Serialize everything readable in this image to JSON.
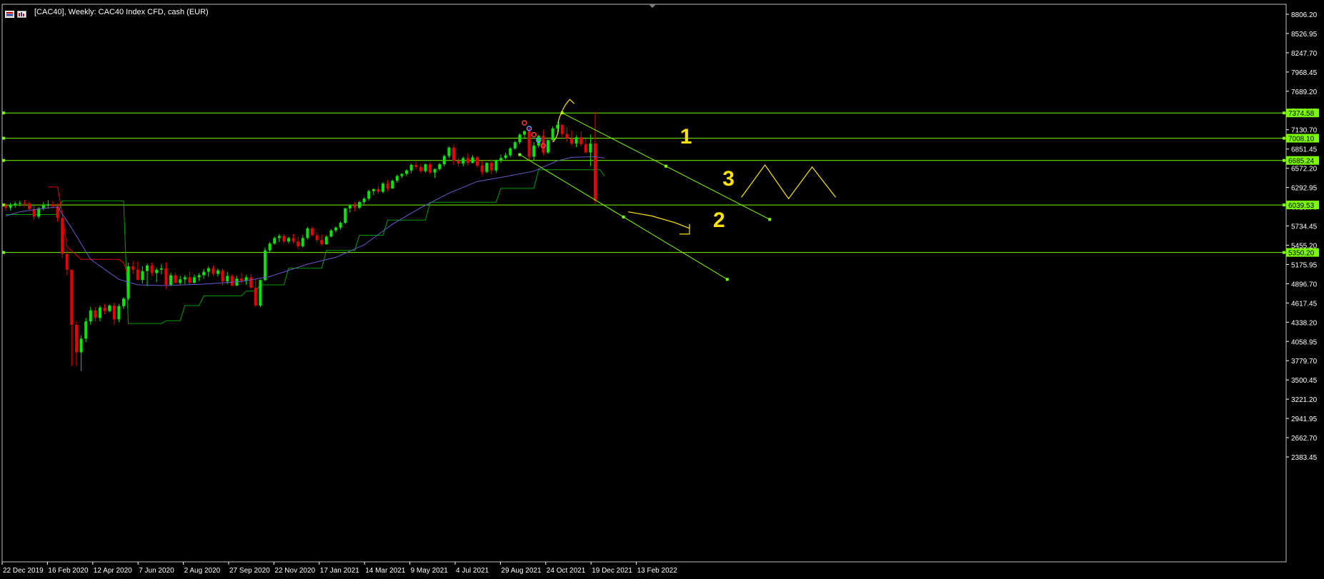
{
  "window": {
    "title": "[CAC40], Weekly:  CAC40 Index CFD, cash (EUR)"
  },
  "colors": {
    "bull": "#00e600",
    "bear": "#e60000",
    "hline": "#7cfc00",
    "ma": "#6a5acd",
    "stopUp": "#00a000",
    "stopDown": "#e00000",
    "annotation": "#ffe400",
    "grid": "#ffffff"
  },
  "chart_data": {
    "type": "candlestick",
    "symbol": "CAC40",
    "timeframe": "Weekly",
    "instrument": "CAC40 Index CFD, cash (EUR)",
    "y_ticks": [
      8806.2,
      8526.95,
      8247.7,
      7968.45,
      7689.2,
      7409.95,
      7130.7,
      6851.45,
      6572.2,
      6292.95,
      6013.7,
      5734.45,
      5455.2,
      5175.95,
      4896.7,
      4617.45,
      4338.2,
      4058.95,
      3779.7,
      3500.45,
      3221.2,
      2941.95,
      2662.7,
      2383.45
    ],
    "y_tick_labels": [
      "8806.20",
      "8526.95",
      "8247.70",
      "7968.45",
      "7689.20",
      "7409.95",
      "7130.70",
      "6851.45",
      "6572.20",
      "6292.95",
      "6013.70",
      "5734.45",
      "5455.20",
      "5175.95",
      "4896.70",
      "4617.45",
      "4338.20",
      "4058.95",
      "3779.70",
      "3500.45",
      "3221.20",
      "2941.95",
      "2662.70",
      "2383.45"
    ],
    "x_tick_labels": [
      "22 Dec 2019",
      "16 Feb 2020",
      "12 Apr 2020",
      "7 Jun 2020",
      "2 Aug 2020",
      "27 Sep 2020",
      "22 Nov 2020",
      "17 Jan 2021",
      "14 Mar 2021",
      "9 May 2021",
      "4 Jul 2021",
      "29 Aug 2021",
      "24 Oct 2021",
      "19 Dec 2021",
      "13 Feb 2022"
    ],
    "horizontal_levels": [
      {
        "value": 7374.58,
        "label": "7374.58"
      },
      {
        "value": 7008.1,
        "label": "7008.10"
      },
      {
        "value": 6685.24,
        "label": "6685.24"
      },
      {
        "value": 6039.53,
        "label": "6039.53"
      },
      {
        "value": 5350.2,
        "label": "5350.20"
      }
    ],
    "candles": [
      [
        6030,
        6060,
        5960,
        6000
      ],
      [
        6000,
        6070,
        5960,
        6040
      ],
      [
        6040,
        6090,
        6000,
        6060
      ],
      [
        6060,
        6100,
        6020,
        6070
      ],
      [
        6070,
        6110,
        6020,
        6060
      ],
      [
        6060,
        6090,
        5960,
        5980
      ],
      [
        5980,
        6030,
        5820,
        5870
      ],
      [
        5870,
        6010,
        5840,
        5990
      ],
      [
        5990,
        6080,
        5960,
        6040
      ],
      [
        6040,
        6110,
        5990,
        6050
      ],
      [
        6050,
        6100,
        5990,
        6020
      ],
      [
        6020,
        6060,
        5800,
        5850
      ],
      [
        5850,
        5860,
        5270,
        5330
      ],
      [
        5330,
        5400,
        5020,
        5100
      ],
      [
        5100,
        4650,
        3700,
        4300
      ],
      [
        4300,
        4350,
        3700,
        3900
      ],
      [
        3900,
        4150,
        3630,
        4100
      ],
      [
        4100,
        4400,
        4050,
        4350
      ],
      [
        4350,
        4560,
        4300,
        4510
      ],
      [
        4510,
        4560,
        4350,
        4400
      ],
      [
        4400,
        4580,
        4350,
        4550
      ],
      [
        4550,
        4600,
        4450,
        4500
      ],
      [
        4500,
        4600,
        4480,
        4580
      ],
      [
        4580,
        4620,
        4300,
        4380
      ],
      [
        4380,
        4600,
        4340,
        4570
      ],
      [
        4570,
        4700,
        4530,
        4680
      ],
      [
        4680,
        5200,
        4650,
        5150
      ],
      [
        5150,
        5230,
        5040,
        5100
      ],
      [
        5100,
        5220,
        5010,
        4950
      ],
      [
        4950,
        5150,
        4900,
        5080
      ],
      [
        5080,
        5190,
        4860,
        5160
      ],
      [
        5160,
        5200,
        5010,
        5050
      ],
      [
        5050,
        5130,
        4920,
        5100
      ],
      [
        5100,
        5180,
        5030,
        5120
      ],
      [
        5120,
        5210,
        4820,
        4880
      ],
      [
        4880,
        5060,
        4860,
        5020
      ],
      [
        5020,
        5060,
        4900,
        4910
      ],
      [
        4910,
        5010,
        4880,
        4960
      ],
      [
        4960,
        5020,
        4890,
        4990
      ],
      [
        4990,
        5070,
        4880,
        4910
      ],
      [
        4910,
        5030,
        4900,
        4990
      ],
      [
        4990,
        5050,
        4940,
        5020
      ],
      [
        5020,
        5110,
        4970,
        5070
      ],
      [
        5070,
        5150,
        5000,
        5120
      ],
      [
        5120,
        5160,
        5010,
        5040
      ],
      [
        5040,
        5120,
        5000,
        5090
      ],
      [
        5090,
        5120,
        4870,
        4930
      ],
      [
        4930,
        5070,
        4890,
        5010
      ],
      [
        5010,
        5040,
        4850,
        4870
      ],
      [
        4870,
        5010,
        4860,
        4970
      ],
      [
        4970,
        5050,
        4900,
        4940
      ],
      [
        4940,
        5020,
        4880,
        4990
      ],
      [
        4990,
        5040,
        4820,
        4840
      ],
      [
        4840,
        4970,
        4560,
        4580
      ],
      [
        4580,
        4960,
        4560,
        4950
      ],
      [
        4950,
        5420,
        4930,
        5380
      ],
      [
        5380,
        5500,
        5350,
        5480
      ],
      [
        5480,
        5580,
        5460,
        5560
      ],
      [
        5560,
        5620,
        5500,
        5590
      ],
      [
        5590,
        5620,
        5480,
        5510
      ],
      [
        5510,
        5580,
        5480,
        5560
      ],
      [
        5560,
        5620,
        5480,
        5510
      ],
      [
        5510,
        5580,
        5400,
        5440
      ],
      [
        5440,
        5600,
        5420,
        5560
      ],
      [
        5560,
        5720,
        5540,
        5700
      ],
      [
        5700,
        5730,
        5580,
        5600
      ],
      [
        5600,
        5640,
        5500,
        5530
      ],
      [
        5530,
        5610,
        5440,
        5470
      ],
      [
        5470,
        5600,
        5460,
        5580
      ],
      [
        5580,
        5690,
        5570,
        5670
      ],
      [
        5670,
        5730,
        5640,
        5710
      ],
      [
        5710,
        5800,
        5680,
        5780
      ],
      [
        5780,
        6000,
        5760,
        5990
      ],
      [
        5990,
        6050,
        5930,
        6030
      ],
      [
        6030,
        6080,
        5950,
        6000
      ],
      [
        6000,
        6100,
        5980,
        6080
      ],
      [
        6080,
        6150,
        6050,
        6130
      ],
      [
        6130,
        6260,
        6100,
        6240
      ],
      [
        6240,
        6280,
        6180,
        6270
      ],
      [
        6270,
        6320,
        6200,
        6230
      ],
      [
        6230,
        6370,
        6210,
        6350
      ],
      [
        6350,
        6400,
        6240,
        6280
      ],
      [
        6280,
        6410,
        6270,
        6390
      ],
      [
        6390,
        6480,
        6360,
        6460
      ],
      [
        6460,
        6500,
        6430,
        6490
      ],
      [
        6490,
        6560,
        6460,
        6540
      ],
      [
        6540,
        6640,
        6500,
        6620
      ],
      [
        6620,
        6660,
        6560,
        6590
      ],
      [
        6590,
        6640,
        6500,
        6530
      ],
      [
        6530,
        6640,
        6510,
        6630
      ],
      [
        6630,
        6660,
        6480,
        6510
      ],
      [
        6510,
        6570,
        6430,
        6560
      ],
      [
        6560,
        6650,
        6540,
        6630
      ],
      [
        6630,
        6770,
        6600,
        6750
      ],
      [
        6750,
        6890,
        6720,
        6870
      ],
      [
        6870,
        6920,
        6620,
        6680
      ],
      [
        6680,
        6720,
        6600,
        6640
      ],
      [
        6640,
        6740,
        6600,
        6720
      ],
      [
        6720,
        6790,
        6620,
        6650
      ],
      [
        6650,
        6760,
        6640,
        6730
      ],
      [
        6730,
        6750,
        6580,
        6610
      ],
      [
        6610,
        6680,
        6480,
        6520
      ],
      [
        6520,
        6660,
        6500,
        6650
      ],
      [
        6650,
        6700,
        6480,
        6540
      ],
      [
        6540,
        6700,
        6510,
        6690
      ],
      [
        6690,
        6770,
        6650,
        6720
      ],
      [
        6720,
        6800,
        6700,
        6760
      ],
      [
        6760,
        6880,
        6730,
        6860
      ],
      [
        6860,
        6970,
        6840,
        6950
      ],
      [
        6950,
        7080,
        6920,
        7060
      ],
      [
        7060,
        7120,
        7000,
        7110
      ],
      [
        7110,
        7160,
        6700,
        6740
      ],
      [
        6740,
        6950,
        6680,
        6900
      ],
      [
        6900,
        7060,
        6870,
        7040
      ],
      [
        7040,
        7130,
        6760,
        6800
      ],
      [
        6800,
        6990,
        6780,
        6980
      ],
      [
        6980,
        7180,
        6970,
        7150
      ],
      [
        7150,
        7250,
        7100,
        7200
      ],
      [
        7200,
        7210,
        7030,
        7070
      ],
      [
        7070,
        7170,
        6960,
        7000
      ],
      [
        7000,
        7120,
        6900,
        6930
      ],
      [
        6930,
        7050,
        6880,
        7020
      ],
      [
        7020,
        7110,
        6890,
        6920
      ],
      [
        6920,
        7000,
        6790,
        6800
      ],
      [
        6800,
        7060,
        6600,
        6930
      ],
      [
        6930,
        7390,
        6070,
        6100
      ]
    ],
    "moving_average": [
      [
        0,
        5880
      ],
      [
        3,
        5940
      ],
      [
        8,
        5990
      ],
      [
        11,
        6010
      ],
      [
        14,
        5700
      ],
      [
        18,
        5250
      ],
      [
        24,
        4960
      ],
      [
        28,
        4880
      ],
      [
        34,
        4870
      ],
      [
        42,
        4890
      ],
      [
        50,
        4930
      ],
      [
        56,
        5000
      ],
      [
        64,
        5180
      ],
      [
        70,
        5280
      ],
      [
        76,
        5460
      ],
      [
        82,
        5760
      ],
      [
        88,
        6000
      ],
      [
        94,
        6210
      ],
      [
        100,
        6380
      ],
      [
        106,
        6450
      ],
      [
        112,
        6530
      ],
      [
        117,
        6680
      ],
      [
        120,
        6730
      ],
      [
        125,
        6740
      ],
      [
        127,
        6720
      ]
    ],
    "trailing_stop_up": [
      [
        0,
        5900
      ],
      [
        11,
        5900
      ],
      [
        12,
        6100
      ],
      [
        25,
        6100
      ],
      [
        26,
        4320
      ],
      [
        33,
        4320
      ],
      [
        34,
        4360
      ],
      [
        37,
        4360
      ],
      [
        38,
        4580
      ],
      [
        41,
        4580
      ],
      [
        42,
        4720
      ],
      [
        50,
        4720
      ],
      [
        51,
        4790
      ],
      [
        53,
        4790
      ],
      [
        54,
        4880
      ],
      [
        59,
        4880
      ],
      [
        60,
        5120
      ],
      [
        67,
        5120
      ],
      [
        68,
        5380
      ],
      [
        74,
        5380
      ],
      [
        75,
        5600
      ],
      [
        80,
        5600
      ],
      [
        81,
        5820
      ],
      [
        89,
        5820
      ],
      [
        90,
        6080
      ],
      [
        104,
        6080
      ],
      [
        105,
        6280
      ],
      [
        112,
        6280
      ],
      [
        113,
        6550
      ],
      [
        126,
        6550
      ],
      [
        127,
        6460
      ]
    ],
    "trailing_stop_down": [
      [
        9,
        6300
      ],
      [
        11,
        6300
      ],
      [
        12,
        5900
      ],
      [
        13,
        5430
      ],
      [
        16,
        5250
      ],
      [
        24,
        5250
      ],
      [
        25,
        5200
      ],
      [
        26,
        5000
      ]
    ],
    "trendlines": [
      {
        "from": [
          118,
          7374.58
        ],
        "to": [
          162,
          5830
        ]
      },
      {
        "from": [
          109,
          6770
        ],
        "to": [
          153,
          4960
        ]
      }
    ],
    "annotations": [
      {
        "text": "1",
        "x": 143,
        "y": 6930
      },
      {
        "text": "2",
        "x": 150,
        "y": 5720
      },
      {
        "text": "3",
        "x": 152,
        "y": 6320
      }
    ],
    "scenario_zigzag": [
      [
        156,
        6150
      ],
      [
        161,
        6620
      ],
      [
        166,
        6130
      ],
      [
        171,
        6590
      ],
      [
        176,
        6150
      ]
    ],
    "projection_curve": [
      [
        132,
        5940
      ],
      [
        137,
        5880
      ],
      [
        142,
        5780
      ],
      [
        145,
        5700
      ]
    ]
  }
}
